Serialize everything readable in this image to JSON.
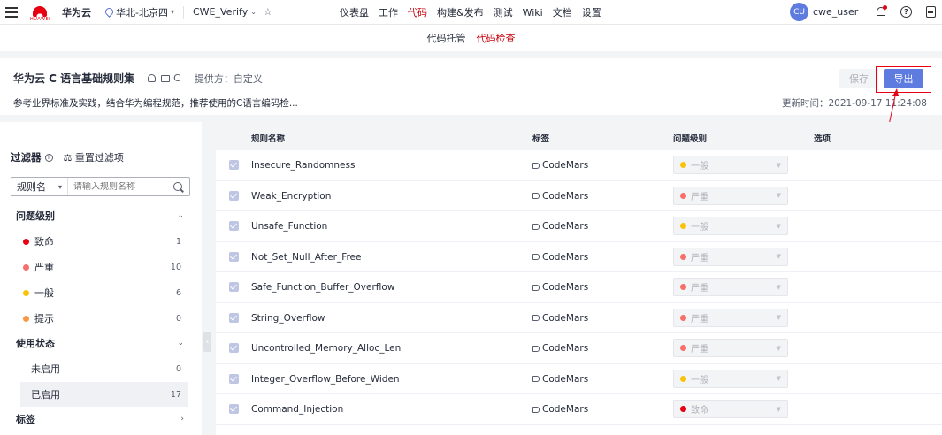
{
  "topbar": {
    "brand": "华为云",
    "logo_text": "HUAWEI",
    "region": "华北-北京四",
    "project": "CWE_Verify",
    "nav": [
      {
        "label": "仪表盘",
        "active": false
      },
      {
        "label": "工作",
        "active": false
      },
      {
        "label": "代码",
        "active": true
      },
      {
        "label": "构建&发布",
        "active": false
      },
      {
        "label": "测试",
        "active": false
      },
      {
        "label": "Wiki",
        "active": false
      },
      {
        "label": "文档",
        "active": false
      },
      {
        "label": "设置",
        "active": false
      }
    ],
    "avatar_initials": "CU",
    "username": "cwe_user"
  },
  "subnav": [
    {
      "label": "代码托管",
      "active": false
    },
    {
      "label": "代码检查",
      "active": true
    }
  ],
  "header": {
    "title": "华为云 C 语言基础规则集",
    "language": "C",
    "provider": "提供方：自定义",
    "description": "参考业界标准及实践，结合华为编程规范，推荐使用的C语言编码检...",
    "save_label": "保存",
    "export_label": "导出",
    "updated": "更新时间：2021-09-17 11:24:08"
  },
  "sidebar": {
    "filter_title": "过滤器",
    "reset_label": "重置过滤项",
    "search_field": "规则名",
    "search_placeholder": "请输入规则名称",
    "sections": {
      "severity": "问题级别",
      "usage": "使用状态",
      "tags": "标签"
    },
    "severity_items": [
      {
        "label": "致命",
        "count": "1",
        "color": "#e60012"
      },
      {
        "label": "严重",
        "count": "10",
        "color": "#f66f6a"
      },
      {
        "label": "一般",
        "count": "6",
        "color": "#fac20a"
      },
      {
        "label": "提示",
        "count": "0",
        "color": "#fa9841"
      }
    ],
    "usage_items": [
      {
        "label": "未启用",
        "count": "0",
        "selected": false
      },
      {
        "label": "已启用",
        "count": "17",
        "selected": true
      }
    ]
  },
  "table": {
    "headers": {
      "name": "规则名称",
      "tag": "标签",
      "level": "问题级别",
      "option": "选项"
    },
    "rows": [
      {
        "name": "Insecure_Randomness",
        "tag": "CodeMars",
        "level": "一般",
        "color": "#fac20a"
      },
      {
        "name": "Weak_Encryption",
        "tag": "CodeMars",
        "level": "严重",
        "color": "#f66f6a"
      },
      {
        "name": "Unsafe_Function",
        "tag": "CodeMars",
        "level": "一般",
        "color": "#fac20a"
      },
      {
        "name": "Not_Set_Null_After_Free",
        "tag": "CodeMars",
        "level": "严重",
        "color": "#f66f6a"
      },
      {
        "name": "Safe_Function_Buffer_Overflow",
        "tag": "CodeMars",
        "level": "严重",
        "color": "#f66f6a"
      },
      {
        "name": "String_Overflow",
        "tag": "CodeMars",
        "level": "严重",
        "color": "#f66f6a"
      },
      {
        "name": "Uncontrolled_Memory_Alloc_Len",
        "tag": "CodeMars",
        "level": "严重",
        "color": "#f66f6a"
      },
      {
        "name": "Integer_Overflow_Before_Widen",
        "tag": "CodeMars",
        "level": "一般",
        "color": "#fac20a"
      },
      {
        "name": "Command_Injection",
        "tag": "CodeMars",
        "level": "致命",
        "color": "#e60012"
      }
    ]
  }
}
